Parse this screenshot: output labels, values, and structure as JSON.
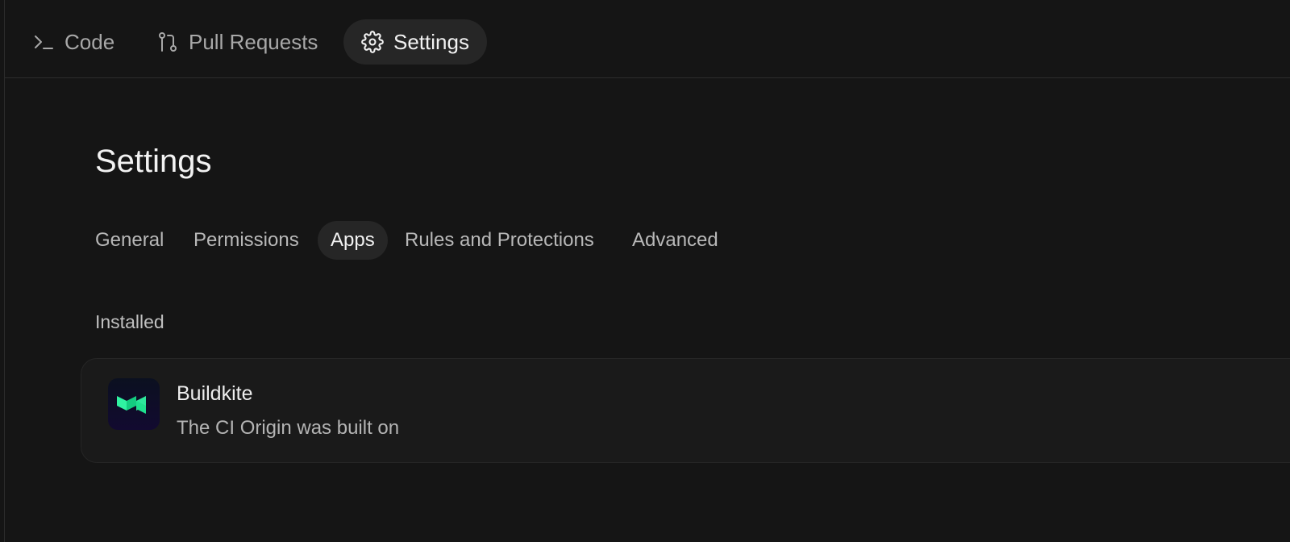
{
  "topnav": {
    "tabs": [
      {
        "label": "Code",
        "icon": "terminal-prompt-icon",
        "active": false
      },
      {
        "label": "Pull Requests",
        "icon": "git-pull-request-icon",
        "active": false
      },
      {
        "label": "Settings",
        "icon": "gear-icon",
        "active": true
      }
    ]
  },
  "page": {
    "title": "Settings"
  },
  "settings_tabs": [
    {
      "label": "General",
      "active": false
    },
    {
      "label": "Permissions",
      "active": false
    },
    {
      "label": "Apps",
      "active": true
    },
    {
      "label": "Rules and Protections",
      "active": false
    },
    {
      "label": "Advanced",
      "active": false
    }
  ],
  "installed": {
    "section_label": "Installed",
    "apps": [
      {
        "name": "Buildkite",
        "description": "The CI Origin was built on",
        "icon": "buildkite-logo-icon",
        "brand_color": "#30f2a2"
      }
    ]
  },
  "colors": {
    "background": "#151515",
    "active_pill": "#262626",
    "card_background": "#1a1a1a"
  }
}
